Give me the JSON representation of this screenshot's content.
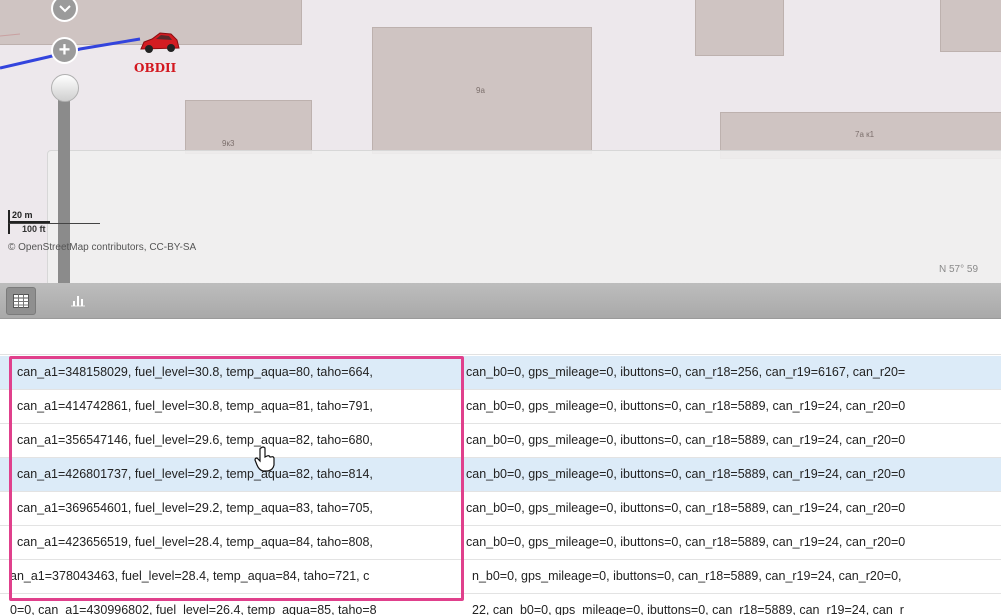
{
  "map": {
    "object_label": "OBDII",
    "scale_metric": "20 m",
    "scale_imperial": "100 ft",
    "attribution": "© OpenStreetMap contributors, CC-BY-SA",
    "coordinates": "N 57° 59",
    "buildings": [
      {
        "label": "9a"
      },
      {
        "label": "9к3"
      },
      {
        "label": "7а к1"
      }
    ],
    "route_color": "#3344dd"
  },
  "toolbar": {
    "table_icon": "table-grid-icon",
    "chart_icon": "bar-chart-icon"
  },
  "rows": [
    {
      "left": "can_a1=348158029, fuel_level=30.8, temp_aqua=80, taho=664,",
      "right": "can_b0=0, gps_mileage=0, ibuttons=0, can_r18=256, can_r19=6167, can_r20=",
      "highlighted": true
    },
    {
      "left": "can_a1=414742861, fuel_level=30.8, temp_aqua=81, taho=791,",
      "right": "can_b0=0, gps_mileage=0, ibuttons=0, can_r18=5889, can_r19=24, can_r20=0",
      "highlighted": false
    },
    {
      "left": "can_a1=356547146, fuel_level=29.6, temp_aqua=82, taho=680,",
      "right": "can_b0=0, gps_mileage=0, ibuttons=0, can_r18=5889, can_r19=24, can_r20=0",
      "highlighted": false
    },
    {
      "left": "can_a1=426801737, fuel_level=29.2, temp_aqua=82, taho=814,",
      "right": "can_b0=0, gps_mileage=0, ibuttons=0, can_r18=5889, can_r19=24, can_r20=0",
      "highlighted": true
    },
    {
      "left": "can_a1=369654601, fuel_level=29.2, temp_aqua=83, taho=705,",
      "right": "can_b0=0, gps_mileage=0, ibuttons=0, can_r18=5889, can_r19=24, can_r20=0",
      "highlighted": false
    },
    {
      "left": "can_a1=423656519, fuel_level=28.4, temp_aqua=84, taho=808,",
      "right": "can_b0=0, gps_mileage=0, ibuttons=0, can_r18=5889, can_r19=24, can_r20=0",
      "highlighted": false
    },
    {
      "left": "an_a1=378043463, fuel_level=28.4, temp_aqua=84, taho=721, c",
      "right": "n_b0=0, gps_mileage=0, ibuttons=0, can_r18=5889, can_r19=24, can_r20=0,",
      "highlighted": false
    },
    {
      "left": "0=0, can_a1=430996802, fuel_level=26.4, temp_aqua=85, taho=8",
      "right": "22, can_b0=0, gps_mileage=0, ibuttons=0, can_r18=5889, can_r19=24, can_r",
      "highlighted": false
    }
  ],
  "colors": {
    "highlight_border": "#e0408c",
    "row_selected": "#dcebf8"
  }
}
